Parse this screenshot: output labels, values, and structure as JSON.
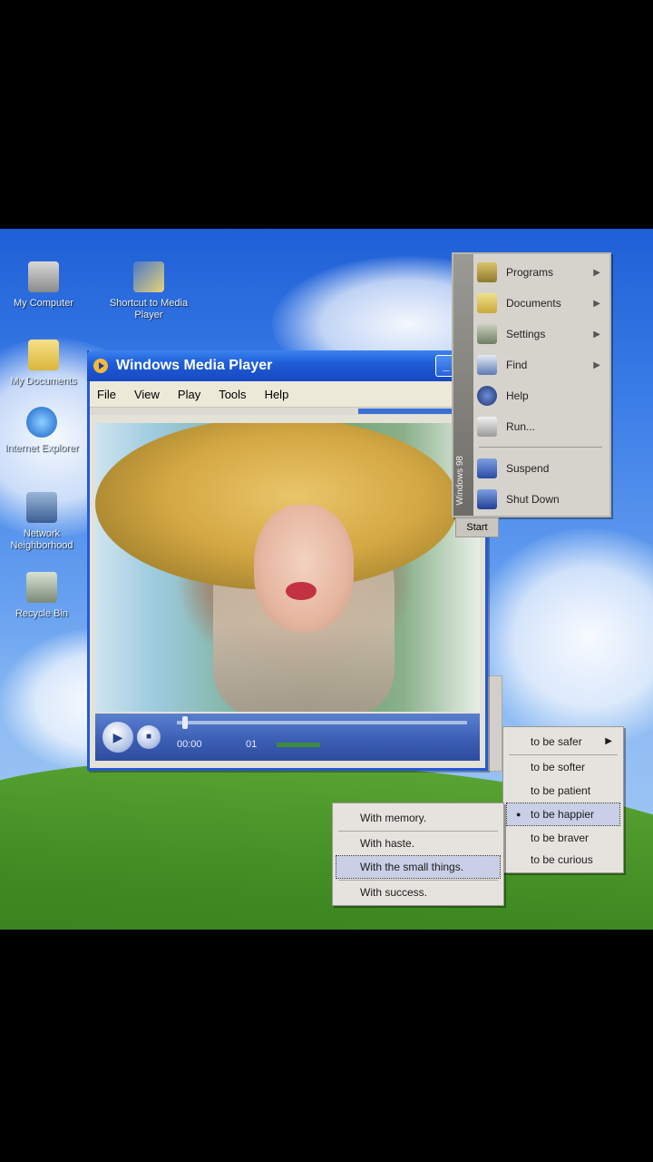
{
  "desktop": {
    "icons": [
      {
        "label": "My Computer",
        "icon": "computer-icon"
      },
      {
        "label": "Shortcut to Media Player",
        "icon": "media-shortcut-icon"
      },
      {
        "label": "My Documents",
        "icon": "folder-icon"
      },
      {
        "label": "Internet Explorer",
        "icon": "internet-explorer-icon"
      },
      {
        "label": "Network Neighborhood",
        "icon": "network-icon"
      },
      {
        "label": "Recycle Bin",
        "icon": "recycle-bin-icon"
      }
    ]
  },
  "media_player": {
    "title": "Windows Media Player",
    "menu": [
      "File",
      "View",
      "Play",
      "Tools",
      "Help"
    ],
    "controls": {
      "play_symbol": "▶",
      "stop_symbol": "■",
      "elapsed": "00:00",
      "status": "01"
    },
    "colors": {
      "titlebar": "#1f5ed8",
      "controls": "#3c5fb5"
    }
  },
  "start_menu": {
    "side_text": "Windows 98",
    "items": [
      {
        "label": "Programs",
        "icon": "programs-icon",
        "arrow": "▶"
      },
      {
        "label": "Documents",
        "icon": "documents-icon",
        "arrow": "▶"
      },
      {
        "label": "Settings",
        "icon": "settings-icon",
        "arrow": "▶"
      },
      {
        "label": "Find",
        "icon": "find-icon",
        "arrow": "▶"
      },
      {
        "label": "Help",
        "icon": "help-icon",
        "arrow": ""
      },
      {
        "label": "Run...",
        "icon": "run-icon",
        "arrow": ""
      },
      {
        "label": "Suspend",
        "icon": "suspend-icon",
        "arrow": ""
      },
      {
        "label": "Shut Down",
        "icon": "shutdown-icon",
        "arrow": ""
      }
    ],
    "start_label": "Start"
  },
  "feelings_menu": {
    "items": [
      {
        "label": "to be safer",
        "arrow": "▶",
        "bullet": ""
      },
      {
        "label": "to be softer",
        "arrow": "",
        "bullet": ""
      },
      {
        "label": "to be patient",
        "arrow": "",
        "bullet": ""
      },
      {
        "label": "to be happier",
        "arrow": "",
        "bullet": "●"
      },
      {
        "label": "to be braver",
        "arrow": "",
        "bullet": ""
      },
      {
        "label": "to be curious",
        "arrow": "",
        "bullet": ""
      }
    ]
  },
  "with_menu": {
    "items": [
      {
        "label": "With memory.",
        "selected": false
      },
      {
        "label": "With haste.",
        "selected": false
      },
      {
        "label": "With the small things.",
        "selected": true
      },
      {
        "label": "With success.",
        "selected": false
      }
    ]
  }
}
